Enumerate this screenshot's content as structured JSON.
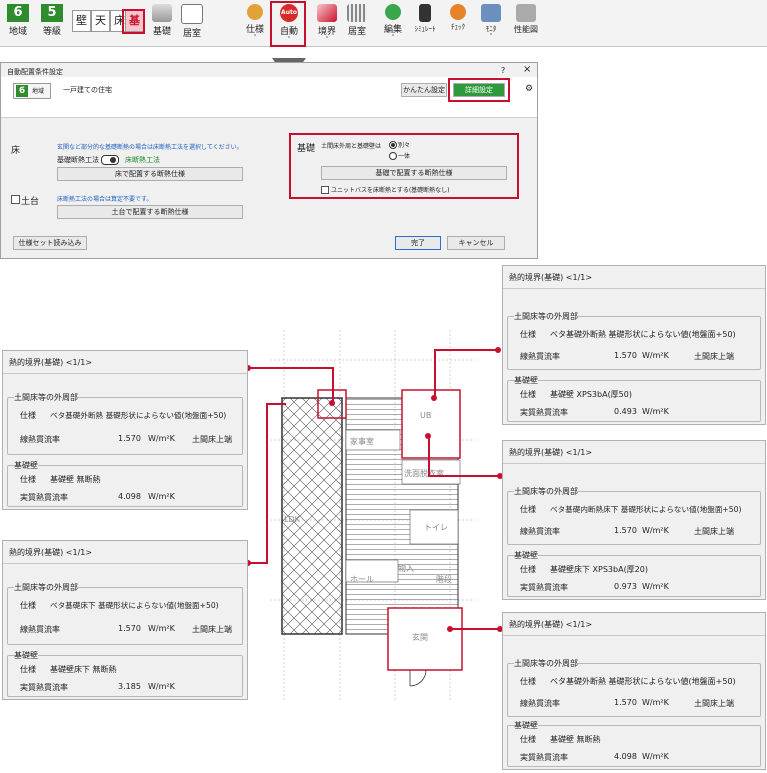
{
  "toolbar": {
    "items": [
      {
        "num": "6",
        "label": "地域"
      },
      {
        "num": "5",
        "label": "等級"
      }
    ],
    "kanji": [
      "壁",
      "天",
      "床",
      "基"
    ],
    "buttons": [
      "基礎",
      "居室",
      "仕様",
      "自動",
      "境界",
      "居室",
      "編集",
      "ｼﾐｭﾚｰﾄ",
      "ﾁｪｯｸ",
      "ﾓﾆﾀ",
      "性能図"
    ],
    "auto_badge": "Auto"
  },
  "dialog": {
    "title": "自動配置条件設定",
    "help": "?",
    "close": "×",
    "region_num": "6",
    "region_label": "地域",
    "house_type": "一戸建ての住宅",
    "simple_btn": "かんたん設定",
    "detail_btn": "詳細設定",
    "floor": {
      "label": "床",
      "note": "玄関など部分的な基礎断熱の場合は床断熱工法を選択してください。",
      "method_label": "基礎断熱工法",
      "method_value": "床断熱工法",
      "place_btn": "床で配置する断熱仕様"
    },
    "dodai": {
      "label": "土台",
      "note": "床断熱工法の場合は算定不要です。",
      "place_btn": "土台で配置する断熱仕様"
    },
    "kiso": {
      "label": "基礎",
      "question": "土間床外周と基礎壁は",
      "opt1": "別々",
      "opt2": "一体",
      "place_btn": "基礎で配置する断熱仕様",
      "unit_bath": "ユニットバスを床断熱とする(基礎断熱なし)"
    },
    "load_btn": "仕様セット読み込み",
    "ok_btn": "完了",
    "cancel_btn": "キャンセル"
  },
  "panels": [
    {
      "title": "熱的境界(基礎)",
      "page": "<1/1>",
      "sec1": "土間床等の外周部",
      "spec_label": "仕様",
      "spec": "ベタ基礎外断熱 基礎形状によらない値(地盤面+50)",
      "psi_label": "線熱貫流率",
      "psi": "1.570",
      "psi_unit": "W/m²K",
      "position": "土間床上端",
      "sec2": "基礎壁",
      "wall_spec": "基礎壁 XPS3bA(厚50)",
      "u_label": "実質熱貫流率",
      "u": "0.493",
      "u_unit": "W/m²K"
    },
    {
      "title": "熱的境界(基礎)",
      "page": "<1/1>",
      "sec1": "土間床等の外周部",
      "spec_label": "仕様",
      "spec": "ベタ基礎外断熱 基礎形状によらない値(地盤面+50)",
      "psi_label": "線熱貫流率",
      "psi": "1.570",
      "psi_unit": "W/m²K",
      "position": "土間床上端",
      "sec2": "基礎壁",
      "wall_spec": "基礎壁 無断熱",
      "u_label": "実質熱貫流率",
      "u": "4.098",
      "u_unit": "W/m²K"
    },
    {
      "title": "熱的境界(基礎)",
      "page": "<1/1>",
      "sec1": "土間床等の外周部",
      "spec_label": "仕様",
      "spec": "ベタ基礎内断熱床下 基礎形状によらない値(地盤面+50)",
      "psi_label": "線熱貫流率",
      "psi": "1.570",
      "psi_unit": "W/m²K",
      "position": "土間床上端",
      "sec2": "基礎壁",
      "wall_spec": "基礎壁床下 XPS3bA(厚20)",
      "u_label": "実質熱貫流率",
      "u": "0.973",
      "u_unit": "W/m²K"
    },
    {
      "title": "熱的境界(基礎)",
      "page": "<1/1>",
      "sec1": "土間床等の外周部",
      "spec_label": "仕様",
      "spec": "ベタ基礎床下 基礎形状によらない値(地盤面+50)",
      "psi_label": "線熱貫流率",
      "psi": "1.570",
      "psi_unit": "W/m²K",
      "position": "土間床上端",
      "sec2": "基礎壁",
      "wall_spec": "基礎壁床下 無断熱",
      "u_label": "実質熱貫流率",
      "u": "3.185",
      "u_unit": "W/m²K"
    },
    {
      "title": "熱的境界(基礎)",
      "page": "<1/1>",
      "sec1": "土間床等の外周部",
      "spec_label": "仕様",
      "spec": "ベタ基礎外断熱 基礎形状によらない値(地盤面+50)",
      "psi_label": "線熱貫流率",
      "psi": "1.570",
      "psi_unit": "W/m²K",
      "position": "土間床上端",
      "sec2": "基礎壁",
      "wall_spec": "基礎壁 無断熱",
      "u_label": "実質熱貫流率",
      "u": "4.098",
      "u_unit": "W/m²K"
    }
  ],
  "plan": {
    "rooms": [
      "UB",
      "家事室",
      "洗面脱衣室",
      "トイレ",
      "物入",
      "ホール",
      "階段",
      "玄関",
      "LDK"
    ]
  },
  "colors": {
    "accent": "#c8102e",
    "green": "#2e8b2e",
    "link": "#1f5fbf"
  }
}
